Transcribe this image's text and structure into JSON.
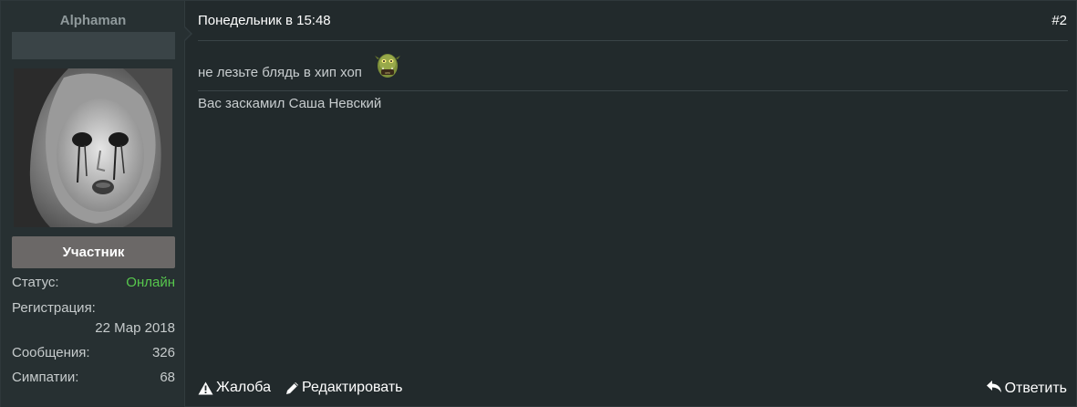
{
  "user": {
    "name": "Alphaman",
    "role": "Участник",
    "stats": {
      "status_label": "Статус:",
      "status_value": "Онлайн",
      "registration_label": "Регистрация:",
      "registration_value": "22 Мар 2018",
      "messages_label": "Сообщения:",
      "messages_value": "326",
      "likes_label": "Симпатии:",
      "likes_value": "68"
    }
  },
  "post": {
    "date": "Понедельник в 15:48",
    "number": "#2",
    "message": "не лезьте блядь в хип хоп",
    "signature": "Вас заскамил Саша Невский"
  },
  "actions": {
    "report": "Жалоба",
    "edit": "Редактировать",
    "reply": "Ответить"
  },
  "icons": {
    "report": "warning-triangle-icon",
    "edit": "pencil-icon",
    "reply": "reply-arrow-icon",
    "smiley": "orc-smiley-icon"
  },
  "colors": {
    "online": "#57c74d",
    "role_badge": "#6b6867"
  }
}
